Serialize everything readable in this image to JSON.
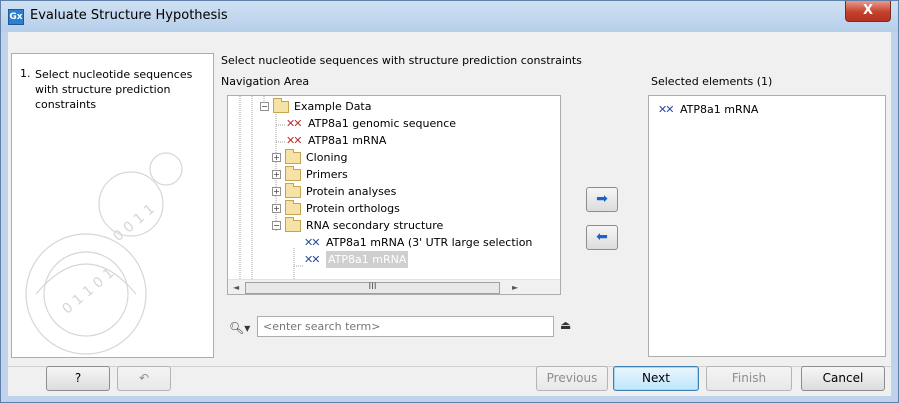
{
  "window": {
    "app_icon": "Gx",
    "title": "Evaluate Structure Hypothesis",
    "close_label": "X"
  },
  "steps": {
    "items": [
      {
        "number": "1.",
        "label": "Select nucleotide sequences with structure prediction constraints"
      }
    ]
  },
  "main": {
    "heading": "Select nucleotide sequences with structure prediction constraints",
    "navigation_label": "Navigation Area",
    "selected_label": "Selected elements (1)"
  },
  "tree": {
    "items": [
      {
        "label": "Example Data",
        "type": "folder",
        "expander": "−"
      },
      {
        "label": "ATP8a1 genomic sequence",
        "type": "dna"
      },
      {
        "label": "ATP8a1 mRNA",
        "type": "dna"
      },
      {
        "label": "Cloning",
        "type": "folder",
        "expander": "+"
      },
      {
        "label": "Primers",
        "type": "folder",
        "expander": "+"
      },
      {
        "label": "Protein analyses",
        "type": "folder",
        "expander": "+"
      },
      {
        "label": "Protein orthologs",
        "type": "folder",
        "expander": "+"
      },
      {
        "label": "RNA secondary structure",
        "type": "folder",
        "expander": "−"
      },
      {
        "label": "ATP8a1 mRNA (3' UTR large selection",
        "type": "rna"
      },
      {
        "label": "ATP8a1 mRNA",
        "type": "rna",
        "selected": true
      }
    ],
    "hscroll_thumb": "III"
  },
  "search": {
    "placeholder": "<enter search term>"
  },
  "selected": {
    "items": [
      {
        "label": "ATP8a1 mRNA",
        "type": "rna"
      }
    ]
  },
  "buttons": {
    "help": "?",
    "previous": "Previous",
    "next": "Next",
    "finish": "Finish",
    "cancel": "Cancel"
  },
  "colors": {
    "dna_icon": "#c03030",
    "rna_icon": "#2c4c9c",
    "move_arrow": "#1e63c4"
  }
}
